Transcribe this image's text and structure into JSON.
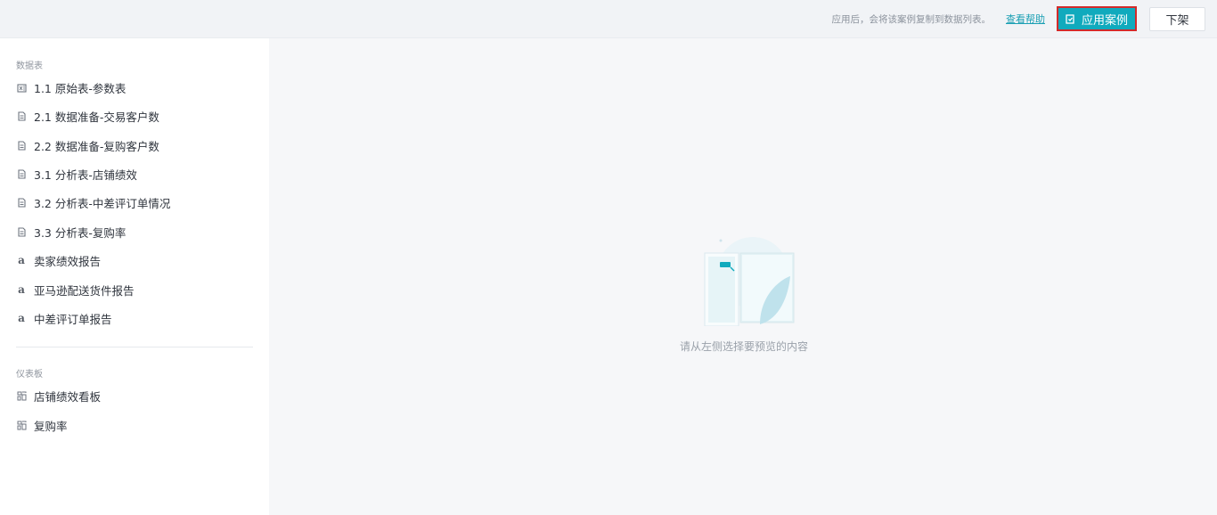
{
  "header": {
    "hint": "应用后，会将该案例复制到数据列表。",
    "help_link": "查看帮助",
    "apply_button": "应用案例",
    "down_button": "下架",
    "apply_icon": "apply-icon"
  },
  "sidebar": {
    "datasets_title": "数据表",
    "datasets": [
      {
        "label": "1.1 原始表-参数表",
        "icon": "excel-table-icon"
      },
      {
        "label": "2.1 数据准备-交易客户数",
        "icon": "document-icon"
      },
      {
        "label": "2.2 数据准备-复购客户数",
        "icon": "document-icon"
      },
      {
        "label": "3.1 分析表-店铺绩效",
        "icon": "document-icon"
      },
      {
        "label": "3.2 分析表-中差评订单情况",
        "icon": "document-icon"
      },
      {
        "label": "3.3 分析表-复购率",
        "icon": "document-icon"
      },
      {
        "label": "卖家绩效报告",
        "icon": "amazon-icon"
      },
      {
        "label": "亚马逊配送货件报告",
        "icon": "amazon-icon"
      },
      {
        "label": "中差评订单报告",
        "icon": "amazon-icon"
      }
    ],
    "dashboards_title": "仪表板",
    "dashboards": [
      {
        "label": "店铺绩效看板",
        "icon": "dashboard-icon"
      },
      {
        "label": "复购率",
        "icon": "dashboard-icon"
      }
    ]
  },
  "main": {
    "empty_text": "请从左侧选择要预览的内容",
    "amazon_glyph": "a"
  },
  "colors": {
    "accent": "#10aabd",
    "highlight_border": "#d32a2a",
    "link": "#1a9fb3"
  }
}
